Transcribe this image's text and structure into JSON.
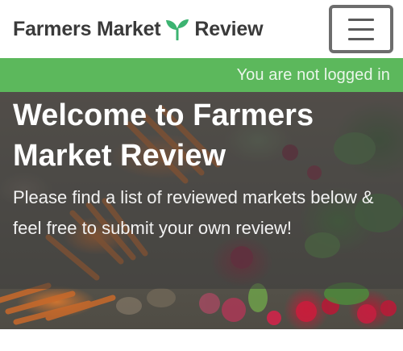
{
  "navbar": {
    "brand_part1": "Farmers Market",
    "brand_part2": "Review",
    "brand_icon": "sprout-icon",
    "menu_icon": "hamburger-menu-icon"
  },
  "status": {
    "text": "You are not logged in",
    "color": "#5cb85c"
  },
  "hero": {
    "title": "Welcome to Farmers Market Review",
    "text": "Please find a list of reviewed markets below & feel free to submit your own review!"
  },
  "colors": {
    "brand_text": "#3a3a3a",
    "sprout": "#3cb371",
    "status_bar": "#5cb85c"
  }
}
